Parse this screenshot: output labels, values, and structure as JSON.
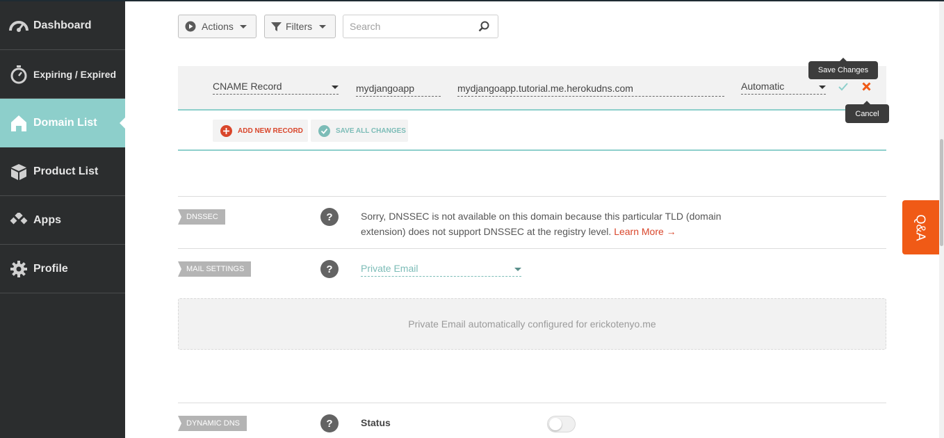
{
  "sidebar": {
    "items": [
      {
        "label": "Dashboard",
        "icon": "speedometer-icon",
        "active": false
      },
      {
        "label": "Expiring / Expired",
        "icon": "stopwatch-icon",
        "active": false
      },
      {
        "label": "Domain List",
        "icon": "home-icon",
        "active": true
      },
      {
        "label": "Product List",
        "icon": "box-icon",
        "active": false
      },
      {
        "label": "Apps",
        "icon": "apps-icon",
        "active": false
      },
      {
        "label": "Profile",
        "icon": "gear-icon",
        "active": false
      }
    ]
  },
  "toolbar": {
    "actions_label": "Actions",
    "filters_label": "Filters",
    "search_placeholder": "Search"
  },
  "record": {
    "type": "CNAME Record",
    "host": "mydjangoapp",
    "value": "mydjangoapp.tutorial.me.herokudns.com",
    "ttl": "Automatic",
    "save_tooltip": "Save Changes",
    "cancel_tooltip": "Cancel"
  },
  "record_actions": {
    "add_label": "ADD NEW RECORD",
    "save_all_label": "SAVE ALL CHANGES"
  },
  "dnssec": {
    "tag": "DNSSEC",
    "help": "?",
    "text": "Sorry, DNSSEC is not available on this domain because this particular TLD (domain extension) does not support DNSSEC at the registry level.",
    "link": "Learn More →"
  },
  "mail": {
    "tag": "MAIL SETTINGS",
    "help": "?",
    "selected": "Private Email",
    "info": "Private Email automatically configured for erickotenyo.me"
  },
  "dynamic_dns": {
    "tag": "DYNAMIC DNS",
    "help": "?",
    "status_label": "Status",
    "enabled": false
  },
  "qa_label": "Q&A",
  "colors": {
    "sidebar_bg": "#2b2d2e",
    "accent": "#8dcfcb",
    "link": "#d9462b",
    "qa": "#f05a16"
  }
}
